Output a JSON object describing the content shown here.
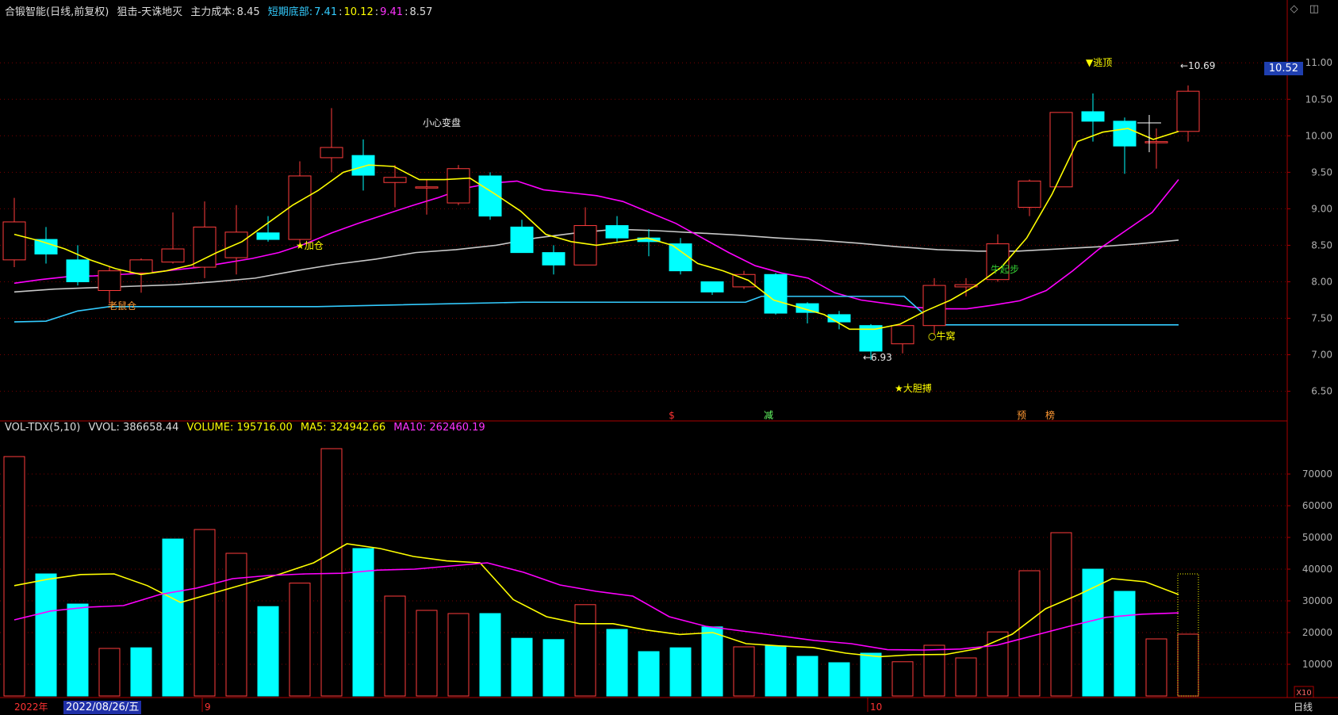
{
  "header": {
    "stock": "合锻智能",
    "period": "(日线,前复权)",
    "indicator": "狙击-天诛地灭",
    "cost_label": "主力成本:",
    "cost_value": "8.45",
    "bottom_label": "短期底部:",
    "bottom_value": "7.41",
    "sep1": ":",
    "v2": "10.12",
    "sep2": ":",
    "v3": "9.41",
    "sep3": ":",
    "v4": "8.57"
  },
  "vol_header": {
    "name": "VOL-TDX(5,10)",
    "vvol": "VVOL: 386658.44",
    "volume": "VOLUME: 195716.00",
    "ma5": "MA5: 324942.66",
    "ma10": "MA10: 262460.19"
  },
  "badges": {
    "current_price": "10.52",
    "date": "2022/08/26/五",
    "period_label": "日线",
    "x10": "X10"
  },
  "x_axis_labels": [
    "2022年",
    "9",
    "10"
  ],
  "colors": {
    "up": "#ff3d3d",
    "down": "#00ffff",
    "ma5": "#ffff00",
    "ma10": "#ff00ff",
    "ma_long": "#c8c8c8",
    "support": "#33ccff",
    "annotation": "#ffff00"
  },
  "chart_data": [
    {
      "type": "candlestick",
      "title": "合锻智能 (日线,前复权)",
      "ylim": [
        6.1,
        11.3
      ],
      "y_ticks": [
        "11.00",
        "10.50",
        "10.00",
        "9.50",
        "9.00",
        "8.50",
        "8.00",
        "7.50",
        "7.00",
        "6.50"
      ],
      "candles": [
        {
          "o": 8.3,
          "h": 9.15,
          "l": 8.2,
          "c": 8.82
        },
        {
          "o": 8.58,
          "h": 8.75,
          "l": 8.25,
          "c": 8.38
        },
        {
          "o": 8.3,
          "h": 8.5,
          "l": 7.95,
          "c": 8.0
        },
        {
          "o": 7.88,
          "h": 8.2,
          "l": 7.7,
          "c": 8.15
        },
        {
          "o": 8.12,
          "h": 8.32,
          "l": 7.85,
          "c": 8.3
        },
        {
          "o": 8.27,
          "h": 8.95,
          "l": 8.25,
          "c": 8.45
        },
        {
          "o": 8.2,
          "h": 9.1,
          "l": 8.05,
          "c": 8.75
        },
        {
          "o": 8.33,
          "h": 9.05,
          "l": 8.1,
          "c": 8.68
        },
        {
          "o": 8.67,
          "h": 8.9,
          "l": 8.55,
          "c": 8.58
        },
        {
          "o": 8.58,
          "h": 9.65,
          "l": 8.5,
          "c": 9.45
        },
        {
          "o": 9.7,
          "h": 10.38,
          "l": 9.5,
          "c": 9.84
        },
        {
          "o": 9.73,
          "h": 9.95,
          "l": 9.25,
          "c": 9.46
        },
        {
          "o": 9.36,
          "h": 9.6,
          "l": 9.02,
          "c": 9.43
        },
        {
          "o": 9.3,
          "h": 9.4,
          "l": 8.92,
          "c": 9.3
        },
        {
          "o": 9.08,
          "h": 9.6,
          "l": 9.05,
          "c": 9.55
        },
        {
          "o": 9.45,
          "h": 9.5,
          "l": 8.85,
          "c": 8.9
        },
        {
          "o": 8.75,
          "h": 8.85,
          "l": 8.4,
          "c": 8.4
        },
        {
          "o": 8.4,
          "h": 8.5,
          "l": 8.1,
          "c": 8.23
        },
        {
          "o": 8.23,
          "h": 9.02,
          "l": 8.23,
          "c": 8.77
        },
        {
          "o": 8.77,
          "h": 8.9,
          "l": 8.55,
          "c": 8.6
        },
        {
          "o": 8.6,
          "h": 8.72,
          "l": 8.35,
          "c": 8.55
        },
        {
          "o": 8.52,
          "h": 8.6,
          "l": 8.1,
          "c": 8.15
        },
        {
          "o": 8.0,
          "h": 8.0,
          "l": 7.82,
          "c": 7.86
        },
        {
          "o": 7.93,
          "h": 8.15,
          "l": 7.9,
          "c": 8.1
        },
        {
          "o": 8.1,
          "h": 8.12,
          "l": 7.55,
          "c": 7.57
        },
        {
          "o": 7.7,
          "h": 7.72,
          "l": 7.43,
          "c": 7.58
        },
        {
          "o": 7.55,
          "h": 7.6,
          "l": 7.35,
          "c": 7.45
        },
        {
          "o": 7.4,
          "h": 7.42,
          "l": 6.93,
          "c": 7.05
        },
        {
          "o": 7.15,
          "h": 7.4,
          "l": 7.02,
          "c": 7.4
        },
        {
          "o": 7.4,
          "h": 8.05,
          "l": 7.28,
          "c": 7.95
        },
        {
          "o": 7.93,
          "h": 8.05,
          "l": 7.8,
          "c": 7.96
        },
        {
          "o": 8.03,
          "h": 8.65,
          "l": 8.0,
          "c": 8.52
        },
        {
          "o": 9.02,
          "h": 9.4,
          "l": 8.9,
          "c": 9.38
        },
        {
          "o": 9.3,
          "h": 10.3,
          "l": 9.3,
          "c": 10.32
        },
        {
          "o": 10.33,
          "h": 10.58,
          "l": 9.92,
          "c": 10.2
        },
        {
          "o": 10.2,
          "h": 10.25,
          "l": 9.48,
          "c": 9.86
        },
        {
          "o": 9.92,
          "h": 10.1,
          "l": 9.55,
          "c": 9.92
        },
        {
          "o": 10.06,
          "h": 10.69,
          "l": 9.92,
          "c": 10.61
        }
      ],
      "ma5": [
        8.65,
        8.56,
        8.45,
        8.3,
        8.18,
        8.1,
        8.15,
        8.23,
        8.4,
        8.55,
        8.8,
        9.05,
        9.25,
        9.5,
        9.6,
        9.58,
        9.4,
        9.4,
        9.42,
        9.2,
        8.97,
        8.65,
        8.55,
        8.5,
        8.55,
        8.6,
        8.5,
        8.25,
        8.15,
        8.02,
        7.75,
        7.65,
        7.55,
        7.35,
        7.35,
        7.42,
        7.6,
        7.75,
        7.95,
        8.2,
        8.6,
        9.2,
        9.92,
        10.05,
        10.1,
        9.95,
        10.06
      ],
      "ma10": [
        7.98,
        8.03,
        8.07,
        8.08,
        8.1,
        8.12,
        8.16,
        8.2,
        8.26,
        8.32,
        8.4,
        8.52,
        8.67,
        8.8,
        8.92,
        9.04,
        9.15,
        9.28,
        9.35,
        9.38,
        9.26,
        9.22,
        9.18,
        9.1,
        8.95,
        8.8,
        8.6,
        8.4,
        8.22,
        8.12,
        8.05,
        7.85,
        7.75,
        7.7,
        7.65,
        7.63,
        7.63,
        7.68,
        7.74,
        7.88,
        8.15,
        8.45,
        8.7,
        8.95,
        9.4
      ],
      "ma_long": [
        7.86,
        7.9,
        7.92,
        7.94,
        7.96,
        8.0,
        8.05,
        8.15,
        8.24,
        8.31,
        8.4,
        8.44,
        8.5,
        8.6,
        8.67,
        8.72,
        8.7,
        8.67,
        8.64,
        8.6,
        8.57,
        8.53,
        8.48,
        8.44,
        8.42,
        8.42,
        8.45,
        8.48,
        8.52,
        8.57
      ],
      "support": [
        7.45,
        7.46,
        7.6,
        7.66,
        7.66,
        7.66,
        7.72,
        7.72,
        7.72,
        7.72,
        7.8,
        7.8,
        7.41,
        7.41
      ],
      "annotations": [
        {
          "text": "老鼠仓",
          "color": "#ff9933"
        },
        {
          "text": "★加仓",
          "color": "#ffff00"
        },
        {
          "text": "小心变盘",
          "color": "#e8e8e8"
        },
        {
          "text": "←6.93",
          "color": "#e8e8e8"
        },
        {
          "text": "○牛窝",
          "color": "#ffff00"
        },
        {
          "text": "★大胆搏",
          "color": "#ffff00"
        },
        {
          "text": "牛起步",
          "color": "#33cc33"
        },
        {
          "text": "▼逃顶",
          "color": "#ffff00"
        },
        {
          "text": "←10.69",
          "color": "#e8e8e8"
        }
      ],
      "markers": [
        {
          "text": "$",
          "color": "#ff3333"
        },
        {
          "text": "减",
          "color": "#66ff66"
        },
        {
          "text": "预",
          "color": "#ff9933"
        },
        {
          "text": "榜",
          "color": "#ff9933"
        }
      ]
    },
    {
      "type": "bar",
      "title": "VOL-TDX(5,10)",
      "ylim": [
        0,
        80000
      ],
      "y_ticks": [
        "70000",
        "60000",
        "50000",
        "40000",
        "30000",
        "20000",
        "10000"
      ],
      "values": [
        75500,
        38500,
        29000,
        15000,
        15200,
        49500,
        52500,
        45000,
        28200,
        35600,
        78000,
        46500,
        31500,
        27000,
        26000,
        26000,
        18200,
        17800,
        28800,
        21000,
        14000,
        15200,
        21800,
        15500,
        15800,
        12500,
        10500,
        13500,
        10800,
        16000,
        12000,
        20200,
        39500,
        51500,
        40000,
        33000,
        18000,
        19500
      ],
      "up": [
        1,
        0,
        0,
        1,
        0,
        0,
        1,
        1,
        0,
        1,
        1,
        0,
        1,
        1,
        1,
        0,
        0,
        0,
        1,
        0,
        0,
        0,
        0,
        1,
        0,
        0,
        0,
        0,
        1,
        1,
        1,
        1,
        1,
        1,
        0,
        0,
        1,
        1
      ],
      "ma5": [
        34800,
        36800,
        38300,
        38500,
        34800,
        29500,
        32500,
        35500,
        38500,
        42000,
        48000,
        46500,
        44000,
        42600,
        42000,
        30400,
        25000,
        22800,
        22800,
        20800,
        19400,
        20000,
        16500,
        15800,
        15300,
        13500,
        12400,
        13000,
        13100,
        15000,
        19500,
        27500,
        32000,
        37000,
        36000,
        32000
      ],
      "ma10": [
        24000,
        26800,
        28000,
        28500,
        32000,
        34000,
        37000,
        38000,
        38500,
        38700,
        39700,
        40000,
        41000,
        42000,
        39000,
        35000,
        33000,
        31500,
        25000,
        22000,
        20500,
        19000,
        17500,
        16500,
        14600,
        14500,
        14800,
        16000,
        19000,
        22000,
        24800,
        25800,
        26200
      ]
    }
  ]
}
